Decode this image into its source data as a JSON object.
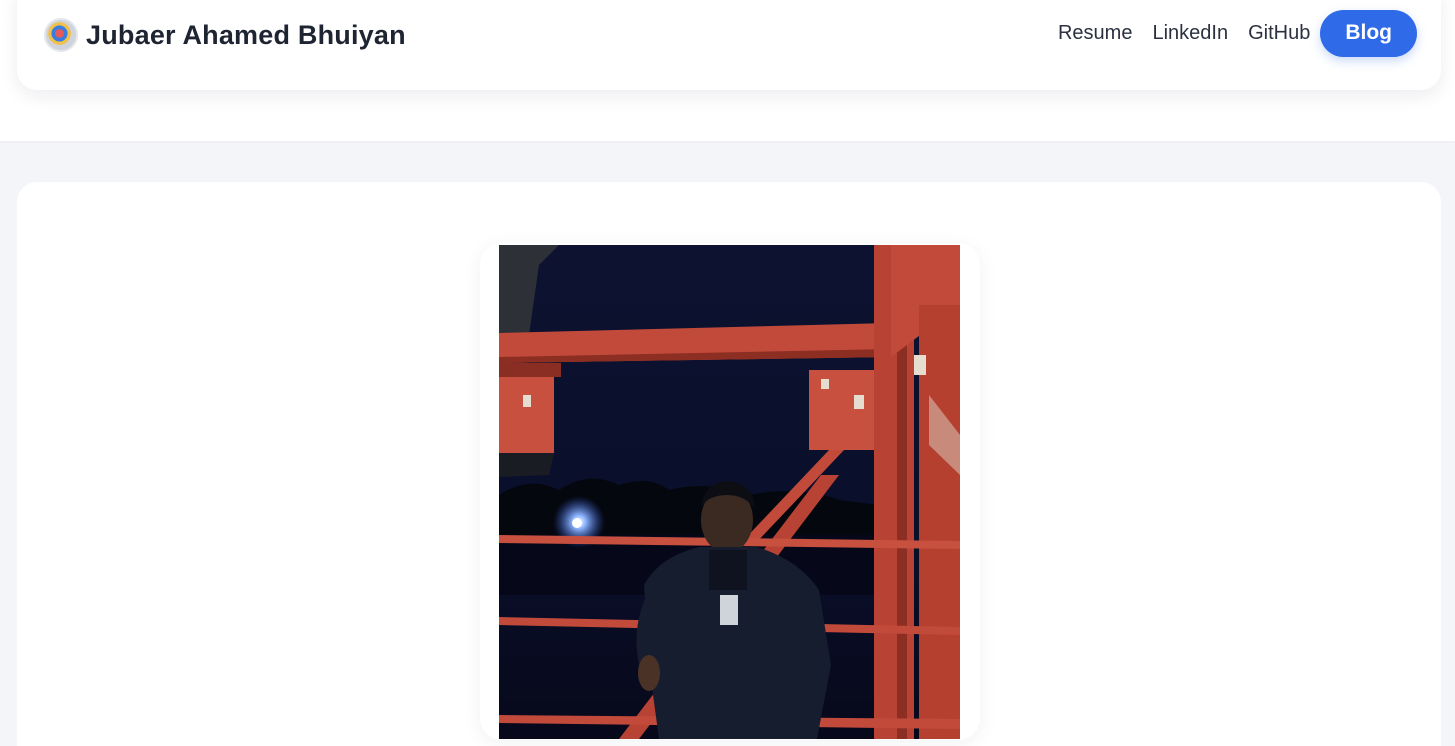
{
  "header": {
    "brand_name": "Jubaer Ahamed Bhuiyan",
    "logo_icon": "avatar-logo-icon",
    "nav": [
      {
        "label": "Resume"
      },
      {
        "label": "LinkedIn"
      },
      {
        "label": "GitHub"
      }
    ],
    "cta_label": "Blog",
    "accent_color": "#2f6be8"
  },
  "main": {
    "photo_icon": "profile-photo"
  }
}
